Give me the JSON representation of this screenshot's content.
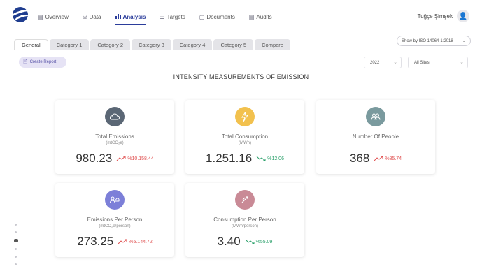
{
  "nav": {
    "items": [
      {
        "label": "Overview",
        "icon": "dashboard-icon",
        "glyph": "▤"
      },
      {
        "label": "Data",
        "icon": "database-icon",
        "glyph": "⛁"
      },
      {
        "label": "Analysis",
        "icon": "chart-icon",
        "glyph": "📊"
      },
      {
        "label": "Targets",
        "icon": "list-icon",
        "glyph": "☰"
      },
      {
        "label": "Documents",
        "icon": "document-icon",
        "glyph": "▢"
      },
      {
        "label": "Audits",
        "icon": "clipboard-icon",
        "glyph": "▤"
      }
    ],
    "active": "Analysis"
  },
  "user": {
    "name": "Tuğçe Şimşek"
  },
  "tabs": [
    "General",
    "Category 1",
    "Category 2",
    "Category 3",
    "Category 4",
    "Category 5",
    "Compare"
  ],
  "active_tab": "General",
  "standard_select": {
    "label": "Show by ISO 14064-1:2018"
  },
  "create_report": {
    "label": "Create Report"
  },
  "filters": {
    "year": "2022",
    "site": "All Sites"
  },
  "page_title": "INTENSITY MEASUREMENTS OF EMISSION",
  "cards": [
    {
      "title": "Total Emissions",
      "unit": "(mtCO₂e)",
      "value": "980.23",
      "change": "%10.158.44",
      "direction": "up",
      "icon": "cloud-icon",
      "color": "#5b6775"
    },
    {
      "title": "Total Consumption",
      "unit": "(MWh)",
      "value": "1.251.16",
      "change": "%12.06",
      "direction": "down",
      "icon": "lightning-icon",
      "color": "#f2c14e"
    },
    {
      "title": "Number Of People",
      "unit": "",
      "value": "368",
      "change": "%85.74",
      "direction": "up",
      "icon": "people-icon",
      "color": "#7a9a9e"
    },
    {
      "title": "Emissions Per Person",
      "unit": "(mtCO₂e/person)",
      "value": "273.25",
      "change": "%5.144.72",
      "direction": "up",
      "icon": "person-cloud-icon",
      "color": "#7c7fd8"
    },
    {
      "title": "Consumption Per Person",
      "unit": "(MWh/person)",
      "value": "3.40",
      "change": "%55.09",
      "direction": "down",
      "icon": "person-bolt-icon",
      "color": "#c98a96"
    }
  ],
  "colors": {
    "brand": "#1f3d8f",
    "accent": "#2b3d9b",
    "up": "#e05050",
    "down": "#2aa06a"
  }
}
